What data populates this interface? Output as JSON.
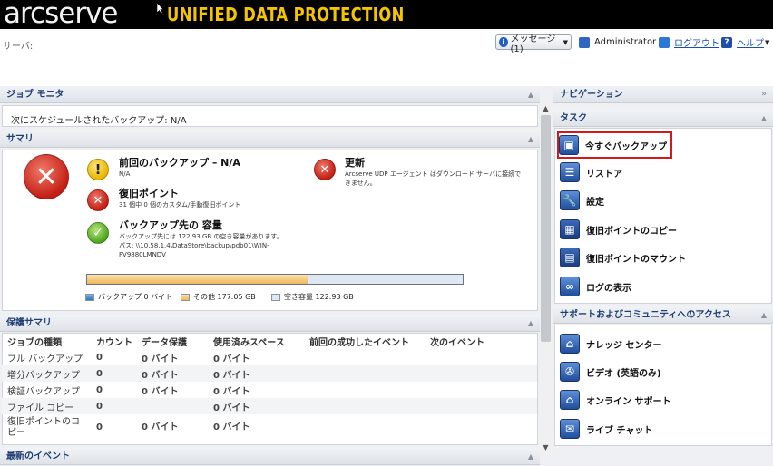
{
  "header": {
    "brand": "arcserve",
    "product": "UNIFIED DATA PROTECTION",
    "server_label": "サーバ:",
    "messages_label": "メッセージ (1)",
    "user": "Administrator",
    "logout": "ログアウト",
    "help": "ヘルプ"
  },
  "job_monitor": {
    "title": "ジョブ モニタ",
    "next_schedule": "次にスケジュールされたバックアップ: N/A"
  },
  "summary": {
    "title": "サマリ",
    "last_backup_title": "前回のバックアップ – N/A",
    "last_backup_sub": "N/A",
    "recovery_title": "復旧ポイント",
    "recovery_sub": "31 個中 0 個のカスタム/手動復旧ポイント",
    "dest_title": "バックアップ先の 容量",
    "dest_sub1": "バックアップ先には 122.93 GB の空き容量があります。",
    "dest_sub2": "パス: \\\\10.58.1.4\\DataStore\\backup\\pdb01\\WIN-",
    "dest_sub3": "FV9880LMNDV",
    "update_title": "更新",
    "update_sub1": "Arcserve UDP エージェント はダウンロード サーバに接続で",
    "update_sub2": "きません。",
    "legend_backup": "バックアップ 0 バイト",
    "legend_other": "その他 177.05 GB",
    "legend_free": "空き容量 122.93 GB",
    "usage": {
      "backup": 0,
      "other": 177.05,
      "free": 122.93
    }
  },
  "protection": {
    "title": "保護サマリ",
    "columns": [
      "ジョブの種類",
      "カウント",
      "データ保護",
      "使用済みスペース",
      "前回の成功したイベント",
      "次のイベント"
    ],
    "rows": [
      [
        "フル バックアップ",
        "0",
        "0 バイト",
        "0 バイト",
        "",
        ""
      ],
      [
        "増分バックアップ",
        "0",
        "0 バイト",
        "0 バイト",
        "",
        ""
      ],
      [
        "検証バックアップ",
        "0",
        "0 バイト",
        "0 バイト",
        "",
        ""
      ],
      [
        "ファイル コピー",
        "0",
        "",
        "0 バイト",
        "",
        ""
      ],
      [
        "復旧ポイントのコピー",
        "0",
        "0 バイト",
        "0 バイト",
        "",
        ""
      ]
    ]
  },
  "recent_events": {
    "title": "最新のイベント"
  },
  "navigation": {
    "title": "ナビゲーション"
  },
  "tasks": {
    "title": "タスク",
    "items": [
      "今すぐバックアップ",
      "リストア",
      "設定",
      "復旧ポイントのコピー",
      "復旧ポイントのマウント",
      "ログの表示"
    ]
  },
  "support": {
    "title": "サポートおよびコミュニティへのアクセス",
    "items": [
      "ナレッジ センター",
      "ビデオ (英語のみ)",
      "オンライン サポート",
      "ライブ チャット"
    ]
  },
  "colors": {
    "accent": "#1f3f73",
    "brand_yellow": "#f5c400",
    "highlight_red": "#d11a1a"
  }
}
